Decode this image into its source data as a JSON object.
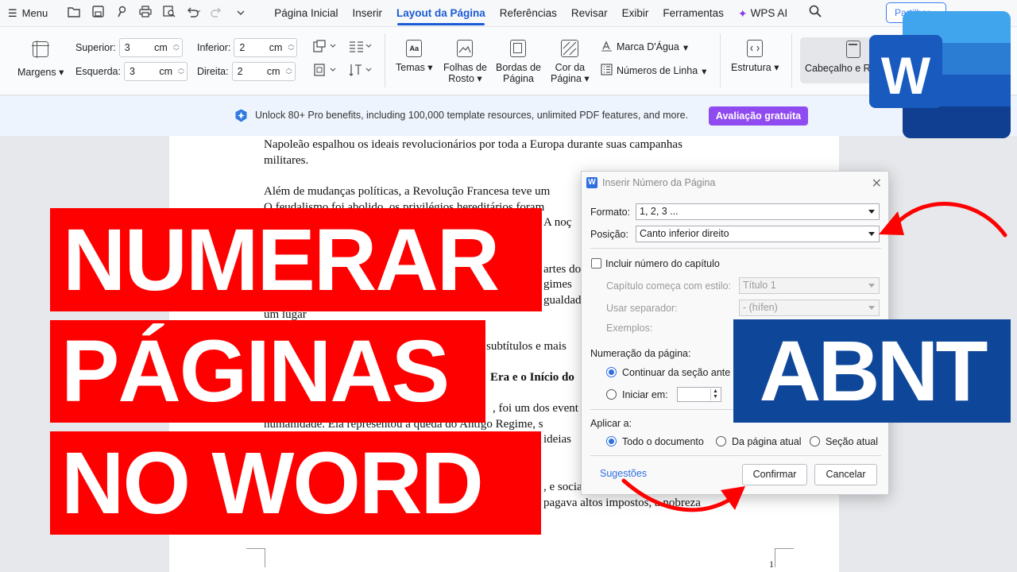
{
  "menubar": {
    "menu_label": "Menu",
    "tabs": [
      "Página Inicial",
      "Inserir",
      "Layout da Página",
      "Referências",
      "Revisar",
      "Exibir",
      "Ferramentas"
    ],
    "active_tab": "Layout da Página",
    "wps_ai": "WPS AI",
    "share_label": "Partilhar"
  },
  "ribbon": {
    "margins": "Margens",
    "superior_label": "Superior:",
    "superior_value": "3",
    "esquerda_label": "Esquerda:",
    "esquerda_value": "3",
    "inferior_label": "Inferior:",
    "inferior_value": "2",
    "direita_label": "Direita:",
    "direita_value": "2",
    "unit": "cm",
    "temas": "Temas",
    "folhas_rosto_1": "Folhas de",
    "folhas_rosto_2": "Rosto",
    "bordas_1": "Bordas de",
    "bordas_2": "Página",
    "cor_1": "Cor da",
    "cor_2": "Página",
    "marca_dagua": "Marca D'Água",
    "numeros_linha": "Números de Linha",
    "estrutura": "Estrutura",
    "cabecalho": "Cabeçalho e Ro"
  },
  "promo": {
    "text": "Unlock 80+ Pro benefits, including 100,000 template resources, unlimited PDF features, and more.",
    "cta": "Avaliação gratuita"
  },
  "document": {
    "p1_l1": "Napoleão espalhou os ideais revolucionários por toda a Europa durante suas campanhas",
    "p1_l2": "militares.",
    "p2_l1": "Além de mudanças políticas, a Revolução Francesa teve um",
    "p2_l2": "O feudalismo foi abolido, os privilégios hereditários foram",
    "p2_l3": "A noç",
    "p3_l1": "artes do",
    "p3_l2": "gimes",
    "p3_l3": "gualdad",
    "p3_l4": "um lugar",
    "p4_l1": "subtítulos e mais",
    "h1": "Era e o Início do",
    "p5_l1": ", foi um dos event",
    "p5_l2": "humanidade. Ela representou a queda do Antigo Regime, s",
    "p5_l3": "ideias",
    "p6_l1": ", e socia",
    "p6_l2": "pagava altos impostos, a nobreza",
    "page_number": "1"
  },
  "dialog": {
    "title": "Inserir Número da Página",
    "formato_label": "Formato:",
    "formato_value": "1, 2, 3 ...",
    "posicao_label": "Posição:",
    "posicao_value": "Canto inferior direito",
    "incluir_capitulo": "Incluir número do capítulo",
    "capitulo_estilo_label": "Capítulo começa com estilo:",
    "capitulo_estilo_value": "Título 1",
    "separador_label": "Usar separador:",
    "separador_value": "- (hífen)",
    "exemplos_label": "Exemplos:",
    "numeracao_label": "Numeração da página:",
    "continuar_label": "Continuar da seção ante",
    "iniciar_label": "Iniciar em:",
    "aplicar_label": "Aplicar a:",
    "todo_doc": "Todo o documento",
    "da_pagina": "Da página atual",
    "secao_atual": "Seção atual",
    "sugestoes": "Sugestões",
    "confirmar": "Confirmar",
    "cancelar": "Cancelar"
  },
  "overlay": {
    "line1": "NUMERAR",
    "line2": "PÁGINAS",
    "line3": "NO WORD",
    "badge": "ABNT",
    "logo_letter": "W"
  },
  "colors": {
    "banner_red": "#fe0000",
    "abnt_blue": "#0e4799",
    "accent_blue": "#1a5bd6",
    "promo_purple": "#8f4bf0"
  }
}
